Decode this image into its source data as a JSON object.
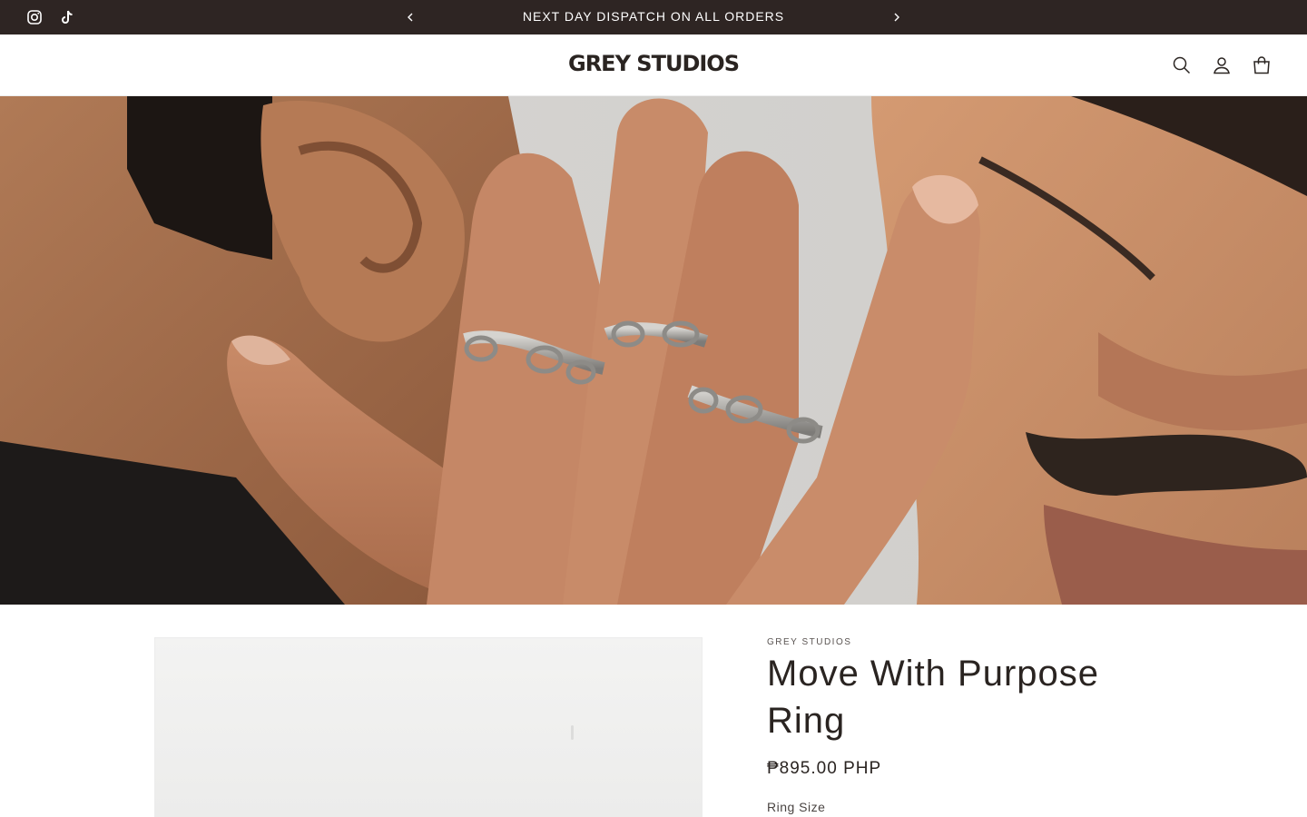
{
  "announcement": {
    "text": "NEXT DAY DISPATCH ON ALL ORDERS",
    "icons": {
      "prev": "chevron-left-icon",
      "next": "chevron-right-icon"
    }
  },
  "social": [
    {
      "name": "instagram-icon"
    },
    {
      "name": "tiktok-icon"
    }
  ],
  "header": {
    "logo": "GREY STUDIOS",
    "icons": [
      "search-icon",
      "account-icon",
      "cart-icon"
    ]
  },
  "product": {
    "vendor": "GREY STUDIOS",
    "title": "Move With Purpose Ring",
    "price": "₱895.00 PHP",
    "option_label": "Ring Size"
  },
  "colors": {
    "announcement_bg": "#2e2523",
    "text": "#2a2421",
    "background": "#ffffff"
  }
}
